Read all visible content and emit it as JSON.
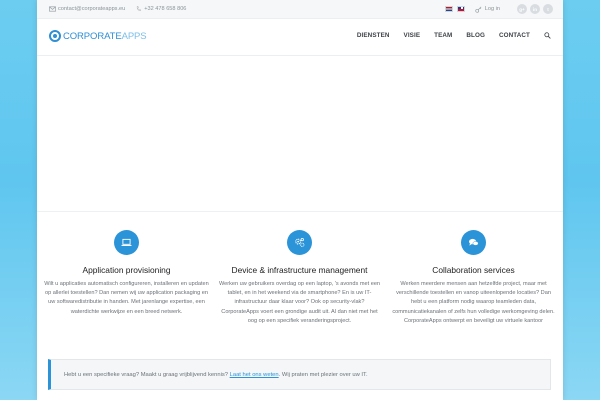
{
  "topbar": {
    "email": "contact@corporateapps.eu",
    "phone": "+32 478 658 806",
    "login": "Log in",
    "languages": [
      "nl",
      "en"
    ],
    "social": [
      {
        "icon": "google-plus-icon",
        "glyph": "g+"
      },
      {
        "icon": "linkedin-icon",
        "glyph": "in"
      },
      {
        "icon": "twitter-icon",
        "glyph": "t"
      }
    ]
  },
  "header": {
    "logo_primary": "CORPORATE",
    "logo_secondary": "APPS",
    "nav": [
      "DIENSTEN",
      "VISIE",
      "TEAM",
      "BLOG",
      "CONTACT"
    ]
  },
  "features": [
    {
      "icon": "laptop-icon",
      "title": "Application provisioning",
      "text": "Wilt u applicaties automatisch configureren, installeren en updaten op allerlei toestellen? Dan nemen wij uw application packaging en uw softwaredistributie in handen. Met jarenlange expertise, een waterdichte werkwijze en een breed netwerk."
    },
    {
      "icon": "gears-icon",
      "title": "Device & infrastructure management",
      "text": "Werken uw gebruikers overdag op een laptop, 's avonds met een tablet, en in het weekend via de smartphone? En is uw IT-infrastructuur daar klaar voor? Ook op security-vlak? CorporateApps voert een grondige audit uit. Al dan niet met het oog op een specifiek veranderingsproject."
    },
    {
      "icon": "chat-icon",
      "title": "Collaboration services",
      "text": "Werken meerdere mensen aan hetzelfde project, maar met verschillende toestellen en vanop uiteenlopende locaties? Dan hebt u een platform nodig waarop teamleden data, communicatiekanalen of zelfs hun volledige werkomgeving delen. CorporateApps ontwerpt en beveiligt uw virtuele kantoor"
    }
  ],
  "callout": {
    "before": "Hebt u een specifieke vraag? Maakt u graag vrijblijvend kennis? ",
    "link": "Laat het ons weten",
    "after": ". Wij praten met plezier over uw IT."
  },
  "colors": {
    "accent": "#2b93d8",
    "background": "#6ccdf0"
  }
}
